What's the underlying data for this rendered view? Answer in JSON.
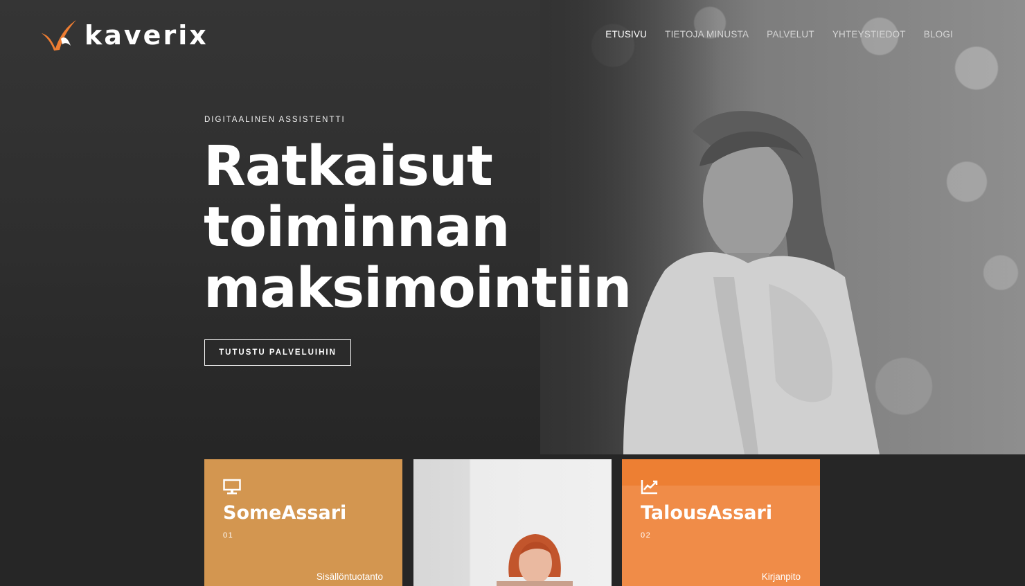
{
  "brand": {
    "name": "kaverix",
    "accent": "#ee7d32"
  },
  "nav": [
    {
      "label": "ETUSIVU",
      "active": true
    },
    {
      "label": "TIETOJA MINUSTA",
      "active": false
    },
    {
      "label": "PALVELUT",
      "active": false
    },
    {
      "label": "YHTEYSTIEDOT",
      "active": false
    },
    {
      "label": "BLOGI",
      "active": false
    }
  ],
  "hero": {
    "eyebrow": "DIGITAALINEN ASSISTENTTI",
    "headline": [
      "Ratkaisut",
      "toiminnan",
      "maksimointiin"
    ],
    "cta": "TUTUSTU PALVELUIHIN"
  },
  "cards": [
    {
      "icon": "monitor-icon",
      "title": "SomeAssari",
      "number": "01",
      "tag": "Sisällöntuotanto",
      "color": "#d39650"
    },
    {
      "icon": "photo-card"
    },
    {
      "icon": "chart-line-icon",
      "title": "TalousAssari",
      "number": "02",
      "tag": "Kirjanpito",
      "color": "#f08c48"
    }
  ]
}
